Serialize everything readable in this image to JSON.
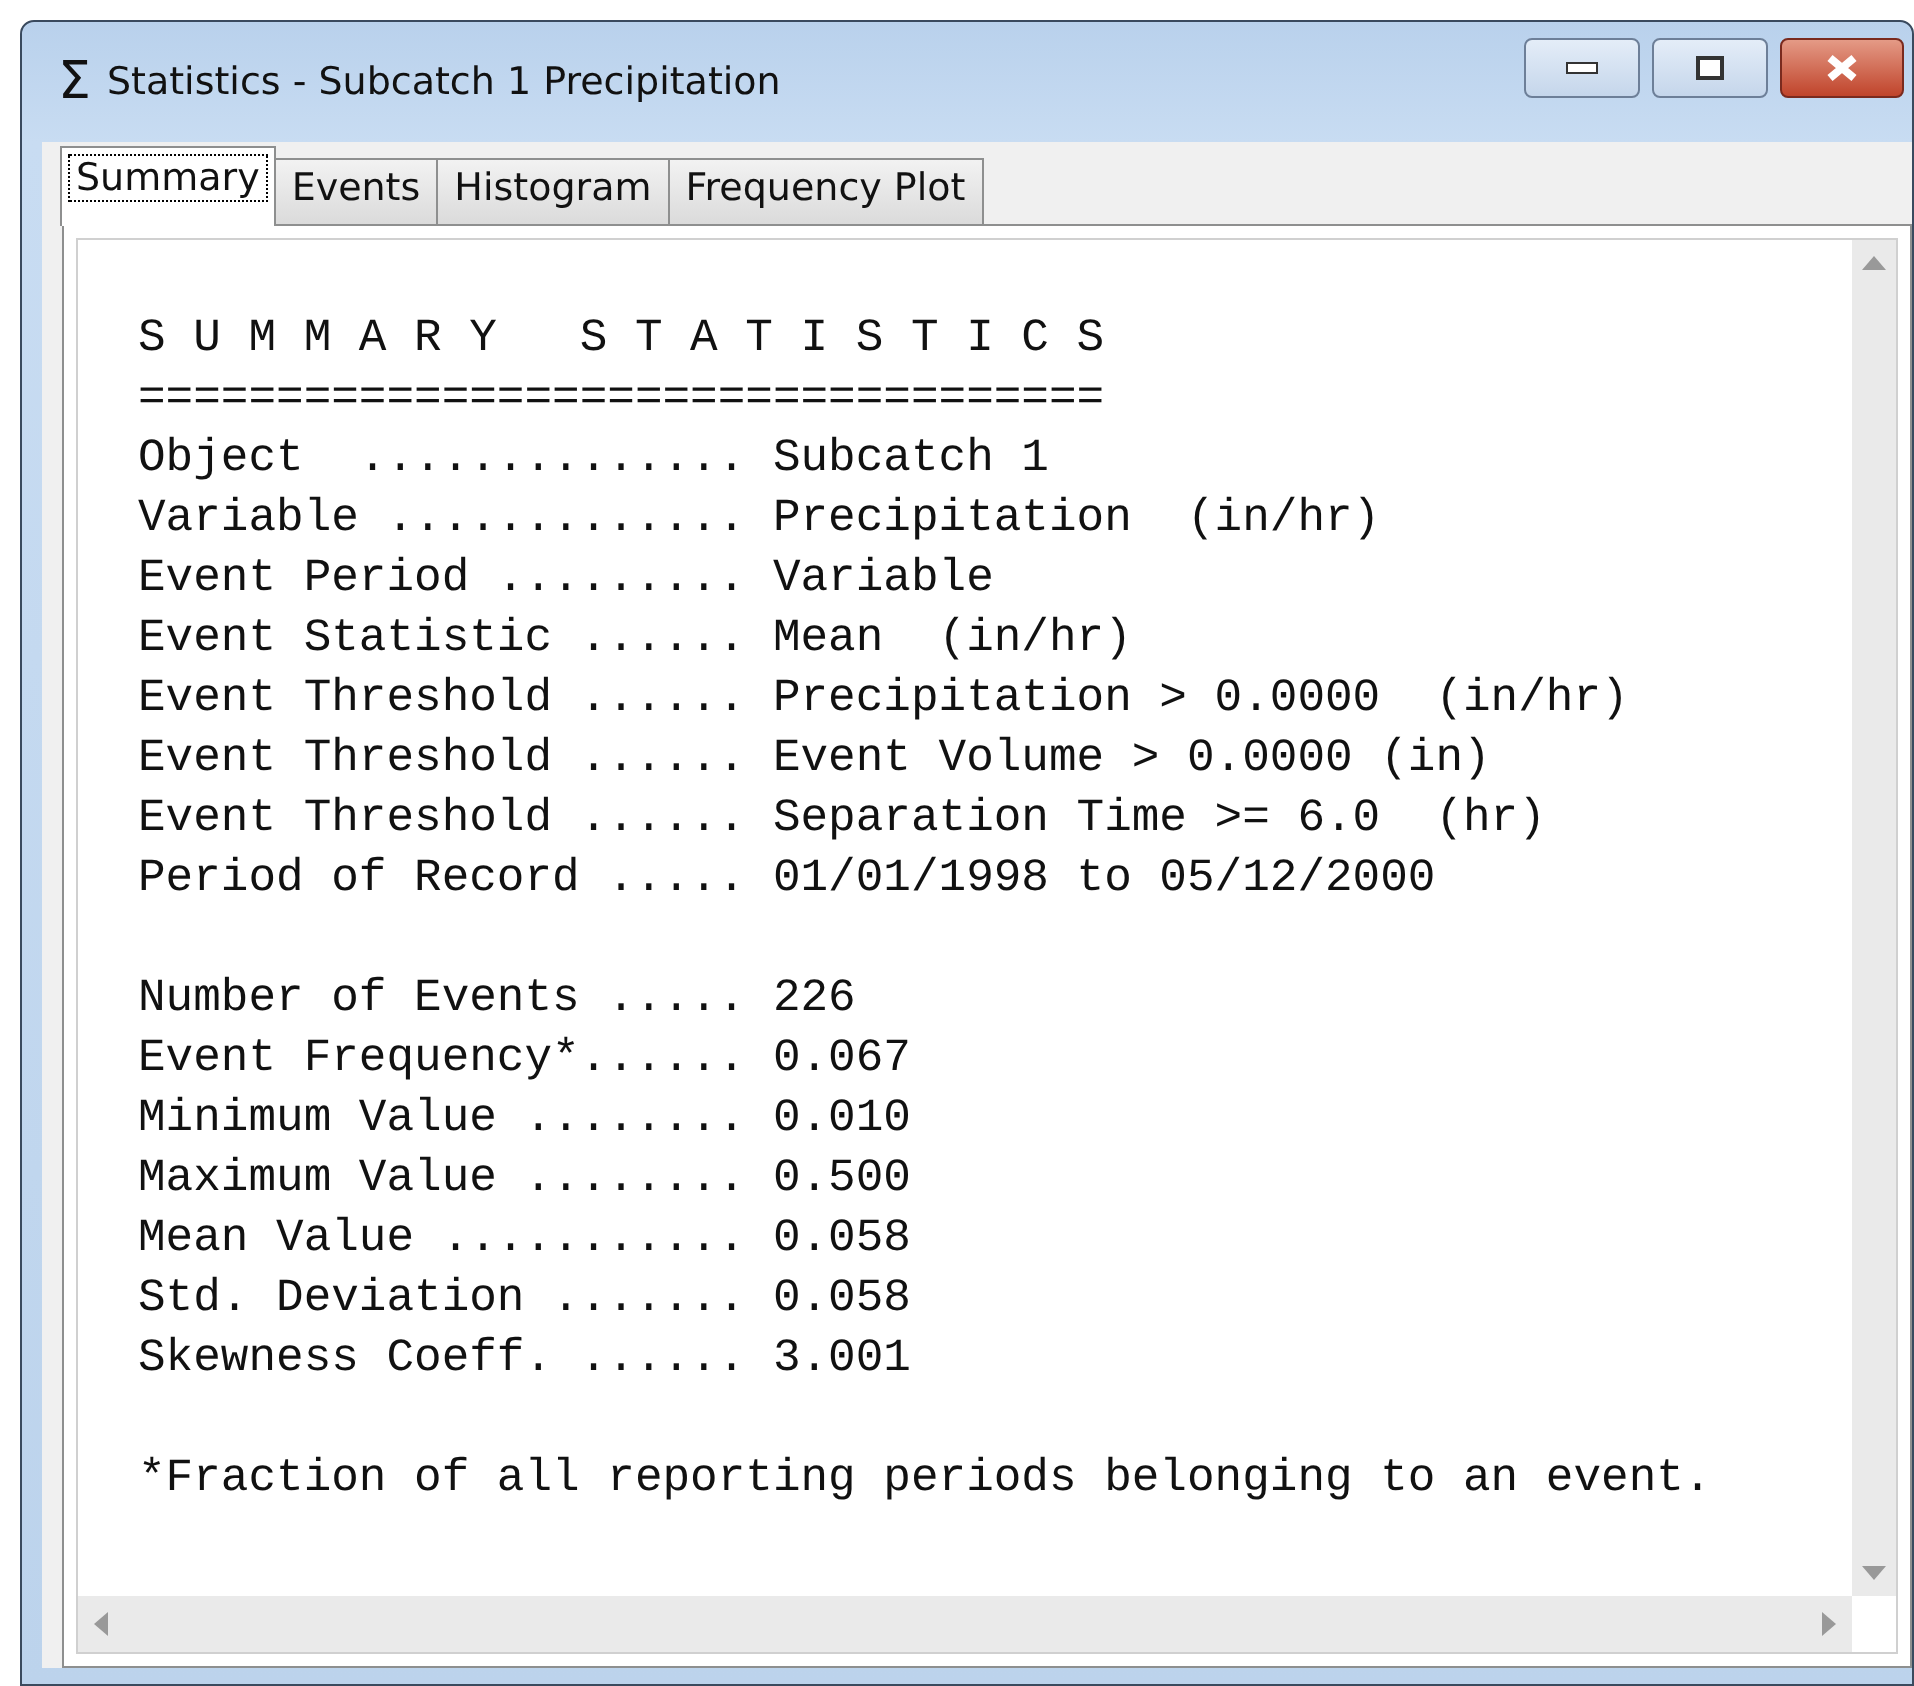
{
  "window": {
    "icon": "Σ",
    "title": "Statistics - Subcatch 1 Precipitation"
  },
  "tabs": [
    {
      "label": "Summary",
      "selected": true
    },
    {
      "label": "Events",
      "selected": false
    },
    {
      "label": "Histogram",
      "selected": false
    },
    {
      "label": "Frequency Plot",
      "selected": false
    }
  ],
  "report": {
    "heading": "S U M M A R Y   S T A T I S T I C S",
    "rule": "===================================",
    "sections": [
      {
        "lines": [
          "Object  .............. Subcatch 1",
          "Variable ............. Precipitation  (in/hr)",
          "Event Period ......... Variable",
          "Event Statistic ...... Mean  (in/hr)",
          "Event Threshold ...... Precipitation > 0.0000  (in/hr)",
          "Event Threshold ...... Event Volume > 0.0000 (in)",
          "Event Threshold ...... Separation Time >= 6.0  (hr)",
          "Period of Record ..... 01/01/1998 to 05/12/2000"
        ]
      },
      {
        "lines": [
          "Number of Events ..... 226",
          "Event Frequency*...... 0.067",
          "Minimum Value ........ 0.010",
          "Maximum Value ........ 0.500",
          "Mean Value ........... 0.058",
          "Std. Deviation ....... 0.058",
          "Skewness Coeff. ...... 3.001"
        ]
      },
      {
        "lines": [
          "*Fraction of all reporting periods belonging to an event."
        ]
      }
    ]
  }
}
